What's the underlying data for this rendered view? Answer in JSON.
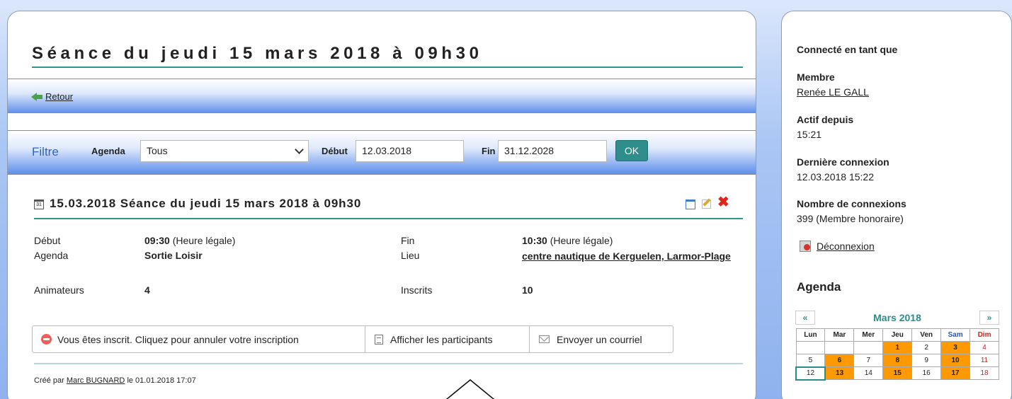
{
  "page": {
    "title": "Séance du jeudi 15 mars 2018 à 09h30",
    "back_label": "Retour"
  },
  "filter": {
    "title": "Filtre",
    "agenda_label": "Agenda",
    "agenda_value": "Tous",
    "start_label": "Début",
    "start_value": "12.03.2018",
    "end_label": "Fin",
    "end_value": "31.12.2028",
    "ok_label": "OK"
  },
  "event": {
    "header": "15.03.2018 Séance du jeudi 15 mars 2018 à 09h30",
    "cal_icon_text": "31",
    "start_label": "Début",
    "start_time": "09:30",
    "start_note": "(Heure légale)",
    "end_label": "Fin",
    "end_time": "10:30",
    "end_note": "(Heure légale)",
    "agenda_label": "Agenda",
    "agenda_value": "Sortie Loisir",
    "place_label": "Lieu",
    "place_value": "centre nautique de Kerguelen, Larmor-Plage",
    "leaders_label": "Animateurs",
    "leaders_value": "4",
    "registered_label": "Inscrits",
    "registered_value": "10",
    "actions": {
      "unregister": "Vous êtes inscrit. Cliquez pour annuler votre inscription",
      "participants": "Afficher les participants",
      "email": "Envoyer un courriel"
    },
    "created": {
      "prefix": "Créé par",
      "author": "Marc BUGNARD",
      "suffix": "le 01.01.2018 17:07"
    }
  },
  "sidebar": {
    "connected_title": "Connecté en tant que",
    "member_label": "Membre",
    "member_name": "Renée LE GALL",
    "active_label": "Actif depuis",
    "active_value": "15:21",
    "last_login_label": "Dernière connexion",
    "last_login_value": "12.03.2018 15:22",
    "count_label": "Nombre de connexions",
    "count_value": "399 (Membre honoraire)",
    "logout_label": "Déconnexion",
    "agenda_title": "Agenda"
  },
  "calendar": {
    "prev": "«",
    "next": "»",
    "month": "Mars 2018",
    "weekdays": [
      "Lun",
      "Mar",
      "Mer",
      "Jeu",
      "Ven",
      "Sam",
      "Dim"
    ],
    "weeks": [
      [
        "",
        "",
        "",
        "1",
        "2",
        "3",
        "4"
      ],
      [
        "5",
        "6",
        "7",
        "8",
        "9",
        "10",
        "11"
      ],
      [
        "12",
        "13",
        "14",
        "15",
        "16",
        "17",
        "18"
      ]
    ],
    "event_days": [
      "1",
      "3",
      "6",
      "8",
      "10",
      "13",
      "15",
      "17"
    ],
    "today": "12"
  },
  "colors": {
    "accent_teal": "#2f8d8c",
    "event_day": "#ff9900",
    "delete_red": "#e0261c"
  },
  "icons": [
    "back-arrow-icon",
    "calendar-icon",
    "copy-icon",
    "edit-icon",
    "delete-icon",
    "unregister-icon",
    "list-icon",
    "mail-icon",
    "logout-icon",
    "pointer-arrow-icon"
  ]
}
